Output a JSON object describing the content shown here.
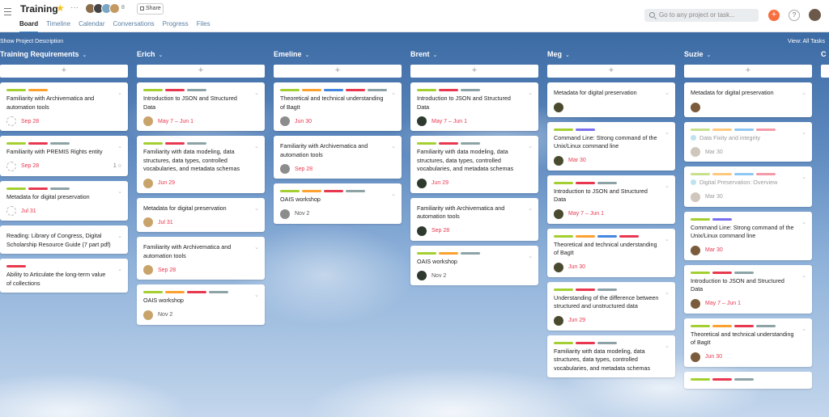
{
  "app": {
    "title": "Training",
    "member_count": "8",
    "share_label": "Share",
    "tabs": [
      {
        "label": "Board",
        "active": true
      },
      {
        "label": "Timeline"
      },
      {
        "label": "Calendar"
      },
      {
        "label": "Conversations"
      },
      {
        "label": "Progress"
      },
      {
        "label": "Files"
      }
    ],
    "search_placeholder": "Go to any project or task...",
    "show_description": "Show Project Description",
    "view_filter": "View: All Tasks"
  },
  "colors": {
    "green": "#a4cf30",
    "orange": "#fca130",
    "red": "#e8384f",
    "gray": "#8da3a6",
    "blue": "#4186e0",
    "purple": "#7a6ff0",
    "light_green": "#c7e08c",
    "light_orange": "#fdc97f",
    "light_blue": "#8ec8f2",
    "pink": "#f59aa7",
    "due_red": "#e8384f",
    "due_gray": "#999999"
  },
  "columns": [
    {
      "name": "Training Requirements",
      "cards": [
        {
          "tags": [
            "green",
            "orange"
          ],
          "title": "Familiarity with Archivematica and automation tools",
          "avatar": "empty",
          "due": "Sep 28"
        },
        {
          "tags": [
            "green",
            "red",
            "gray"
          ],
          "title": "Familiarity with PREMIS Rights entity",
          "avatar": "empty",
          "due": "Sep 28",
          "comments": "1"
        },
        {
          "tags": [
            "green",
            "red",
            "gray"
          ],
          "title": "Metadata for digital preservation",
          "avatar": "empty",
          "due": "Jul 31"
        },
        {
          "tags": [],
          "title": "Reading: Library of Congress, Digital Scholarship Resource Guide (7 part pdf)"
        },
        {
          "tags": [
            "red"
          ],
          "title": "Ability to Articulate the long-term value of collections"
        }
      ]
    },
    {
      "name": "Erich",
      "cards": [
        {
          "tags": [
            "green",
            "red",
            "gray"
          ],
          "title": "Introduction to JSON and Structured Data",
          "avatar": "dog",
          "due": "May 7 – Jun 1"
        },
        {
          "tags": [
            "green",
            "red",
            "gray"
          ],
          "title": "Familiarity with data modeling, data structures, data types, controlled vocabularies, and metadata schemas",
          "avatar": "dog",
          "due": "Jun 29"
        },
        {
          "tags": [],
          "title": "Metadata for digital preservation",
          "avatar": "dog",
          "due": "Jul 31"
        },
        {
          "tags": [],
          "title": "Familiarity with Archivematica and automation tools",
          "avatar": "dog",
          "due": "Sep 28"
        },
        {
          "tags": [
            "green",
            "orange",
            "red",
            "gray"
          ],
          "title": "OAIS workshop",
          "avatar": "dog",
          "due": "Nov 2",
          "due_style": "gray"
        }
      ]
    },
    {
      "name": "Emeline",
      "cards": [
        {
          "tags": [
            "green",
            "orange",
            "blue",
            "red",
            "gray"
          ],
          "title": "Theoretical and technical understanding of BagIt",
          "avatar": "mosaic",
          "due": "Jun 30"
        },
        {
          "tags": [],
          "title": "Familiarity with Archivematica and automation tools",
          "avatar": "mosaic",
          "due": "Sep 28"
        },
        {
          "tags": [
            "green",
            "orange",
            "red",
            "gray"
          ],
          "title": "OAIS workshop",
          "avatar": "mosaic",
          "due": "Nov 2",
          "due_style": "gray"
        }
      ]
    },
    {
      "name": "Brent",
      "cards": [
        {
          "tags": [
            "green",
            "red",
            "gray"
          ],
          "title": "Introduction to JSON and Structured Data",
          "avatar": "dark",
          "due": "May 7 – Jun 1"
        },
        {
          "tags": [
            "green",
            "red",
            "gray"
          ],
          "title": "Familiarity with data modeling, data structures, data types, controlled vocabularies, and metadata schemas",
          "avatar": "dark",
          "due": "Jun 29"
        },
        {
          "tags": [],
          "title": "Familiarity with Archivematica and automation tools",
          "avatar": "dark",
          "due": "Sep 28"
        },
        {
          "tags": [
            "green",
            "orange",
            "gray"
          ],
          "title": "OAIS workshop",
          "avatar": "dark",
          "due": "Nov 2",
          "due_style": "gray"
        }
      ]
    },
    {
      "name": "Meg",
      "cards": [
        {
          "tags": [],
          "title": "Metadata for digital preservation",
          "avatar": "bee"
        },
        {
          "tags": [
            "green",
            "purple"
          ],
          "title": "Command Line: Strong command of the Unix/Linux command line",
          "avatar": "bee",
          "due": "Mar 30"
        },
        {
          "tags": [
            "green",
            "red",
            "gray"
          ],
          "title": "Introduction to JSON and Structured Data",
          "avatar": "bee",
          "due": "May 7 – Jun 1"
        },
        {
          "tags": [
            "green",
            "orange",
            "blue",
            "red"
          ],
          "title": "Theoretical and technical understanding of BagIt",
          "avatar": "bee",
          "due": "Jun 30"
        },
        {
          "tags": [
            "green",
            "red",
            "gray"
          ],
          "title": "Understanding of the difference between structured and unstructured data",
          "avatar": "bee",
          "due": "Jun 29"
        },
        {
          "tags": [
            "green",
            "red",
            "gray"
          ],
          "title": "Familiarity with data modeling, data structures, data types, controlled vocabularies, and metadata schemas"
        }
      ]
    },
    {
      "name": "Suzie",
      "cards": [
        {
          "tags": [],
          "title": "Metadata for digital preservation",
          "avatar": "brown"
        },
        {
          "tags": [
            "light_green",
            "light_orange",
            "light_blue",
            "pink"
          ],
          "title": "Data Fixity and integrity",
          "avatar": "faded",
          "due": "Mar 30",
          "faded": true,
          "subtask": true
        },
        {
          "tags": [
            "light_green",
            "light_orange",
            "light_blue",
            "pink"
          ],
          "title": "Digital Preservation: Overview",
          "avatar": "faded",
          "due": "Mar 30",
          "faded": true,
          "subtask": true
        },
        {
          "tags": [
            "green",
            "purple"
          ],
          "title": "Command Line: Strong command of the Unix/Linux command line",
          "avatar": "brown",
          "due": "Mar 30"
        },
        {
          "tags": [
            "green",
            "red",
            "gray"
          ],
          "title": "Introduction to JSON and Structured Data",
          "avatar": "brown",
          "due": "May 7 – Jun 1"
        },
        {
          "tags": [
            "green",
            "orange",
            "red",
            "gray"
          ],
          "title": "Theoretical and technical understanding of BagIt",
          "avatar": "brown",
          "due": "Jun 30"
        },
        {
          "tags": [
            "green",
            "red",
            "gray"
          ]
        }
      ]
    },
    {
      "name": "C",
      "cards": []
    }
  ]
}
